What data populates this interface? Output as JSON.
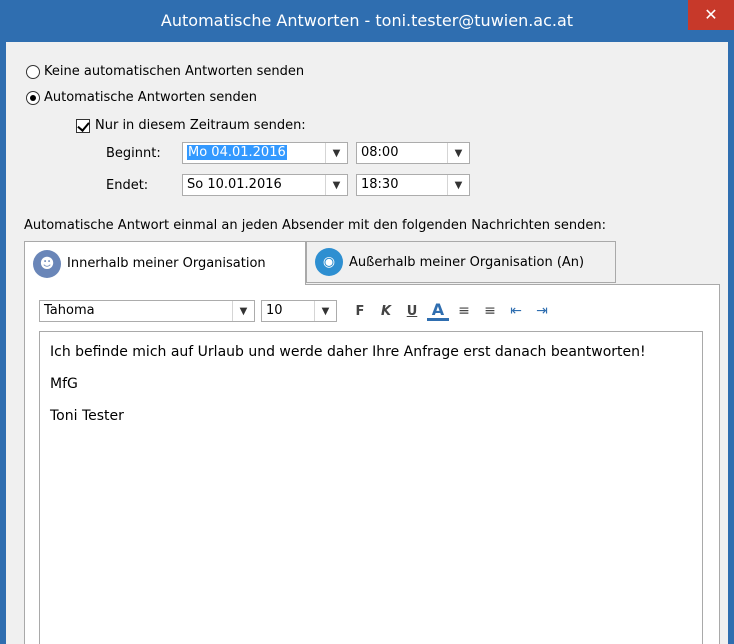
{
  "window": {
    "title": "Automatische Antworten - toni.tester@tuwien.ac.at",
    "close_glyph": "✕"
  },
  "options": {
    "no_auto_label": "Keine automatischen Antworten senden",
    "no_auto_selected": false,
    "send_auto_label": "Automatische Antworten senden",
    "send_auto_selected": true,
    "period_label": "Nur in diesem Zeitraum senden:",
    "period_checked": true
  },
  "schedule": {
    "start_label": "Beginnt:",
    "start_date": "Mo 04.01.2016",
    "start_time": "08:00",
    "end_label": "Endet:",
    "end_date": "So 10.01.2016",
    "end_time": "18:30"
  },
  "description": "Automatische Antwort einmal an jeden Absender mit den folgenden Nachrichten senden:",
  "tabs": [
    {
      "label": "Innerhalb meiner Organisation",
      "active": true,
      "icon": "users-icon"
    },
    {
      "label": "Außerhalb meiner Organisation (An)",
      "active": false,
      "icon": "globe-icon"
    }
  ],
  "formatting": {
    "font": "Tahoma",
    "size": "10",
    "bold": "F",
    "italic": "K",
    "underline": "U",
    "font_color": "A",
    "font_color_hex": "#2f6eb0"
  },
  "message": {
    "line1": "Ich befinde mich auf Urlaub und werde daher Ihre Anfrage erst danach beantworten!",
    "line2": "MfG",
    "line3": "Toni Tester"
  }
}
